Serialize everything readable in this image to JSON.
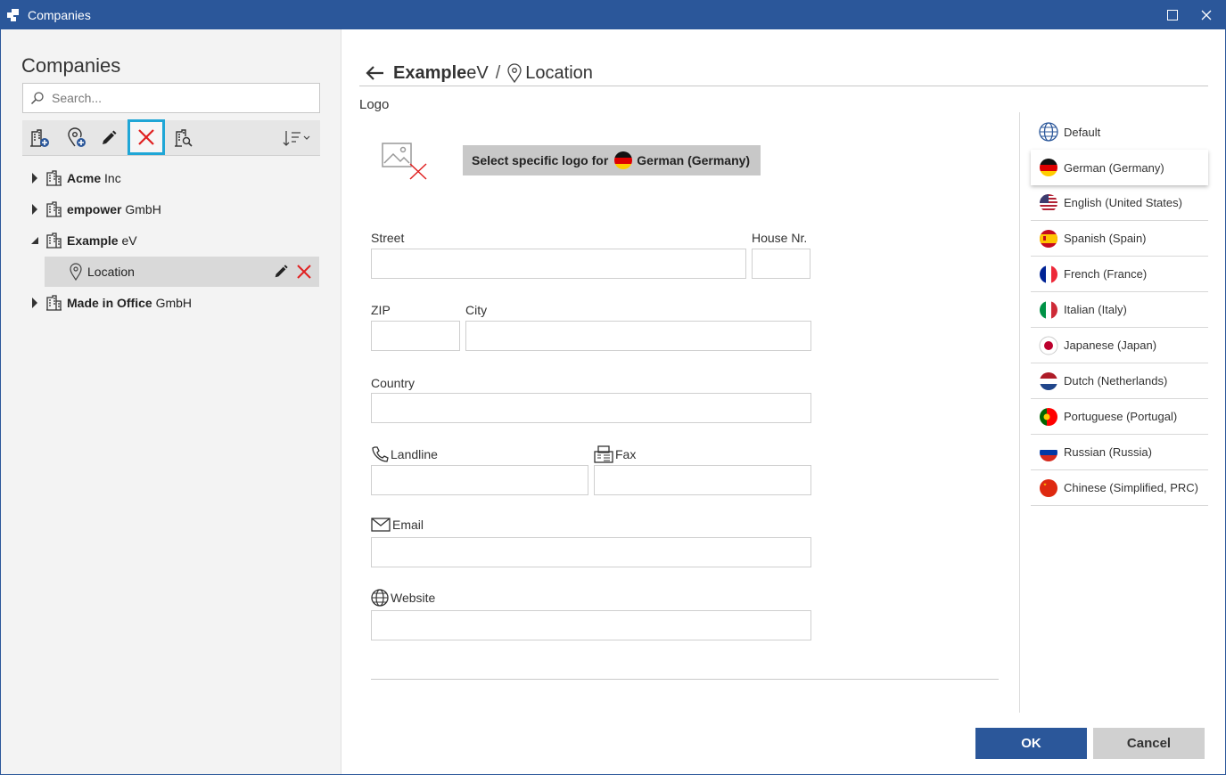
{
  "window": {
    "title": "Companies"
  },
  "left": {
    "title": "Companies",
    "search_placeholder": "Search...",
    "toolbar": {
      "icons": [
        "add-company-icon",
        "add-location-icon",
        "edit-pencil-icon",
        "delete-x-icon",
        "search-company-icon",
        "sort-icon"
      ]
    },
    "tree": [
      {
        "bold": "Acme",
        "rest": "Inc",
        "expanded": false
      },
      {
        "bold": "empower",
        "rest": "GmbH",
        "expanded": false
      },
      {
        "bold": "Example",
        "rest": "eV",
        "expanded": true
      },
      {
        "bold": "Made in Office",
        "rest": "GmbH",
        "expanded": false
      }
    ],
    "child": {
      "label": "Location"
    }
  },
  "content": {
    "breadcrumb": {
      "company_bold": "Example",
      "company_rest": "eV",
      "separator": "/",
      "page": "Location"
    },
    "logo_label": "Logo",
    "select_logo": {
      "prefix": "Select specific logo for",
      "language": "German (Germany)"
    },
    "fields": {
      "street": "Street",
      "house_nr": "House Nr.",
      "zip": "ZIP",
      "city": "City",
      "country": "Country",
      "landline": "Landline",
      "fax": "Fax",
      "email": "Email",
      "website": "Website"
    },
    "languages": [
      "Default",
      "German (Germany)",
      "English (United States)",
      "Spanish (Spain)",
      "French (France)",
      "Italian (Italy)",
      "Japanese (Japan)",
      "Dutch (Netherlands)",
      "Portuguese (Portugal)",
      "Russian (Russia)",
      "Chinese (Simplified, PRC)"
    ],
    "ok": "OK",
    "cancel": "Cancel"
  },
  "colors": {
    "accent": "#2b579a",
    "selection_border": "#1fa6d6",
    "delete_red": "#e02020"
  }
}
